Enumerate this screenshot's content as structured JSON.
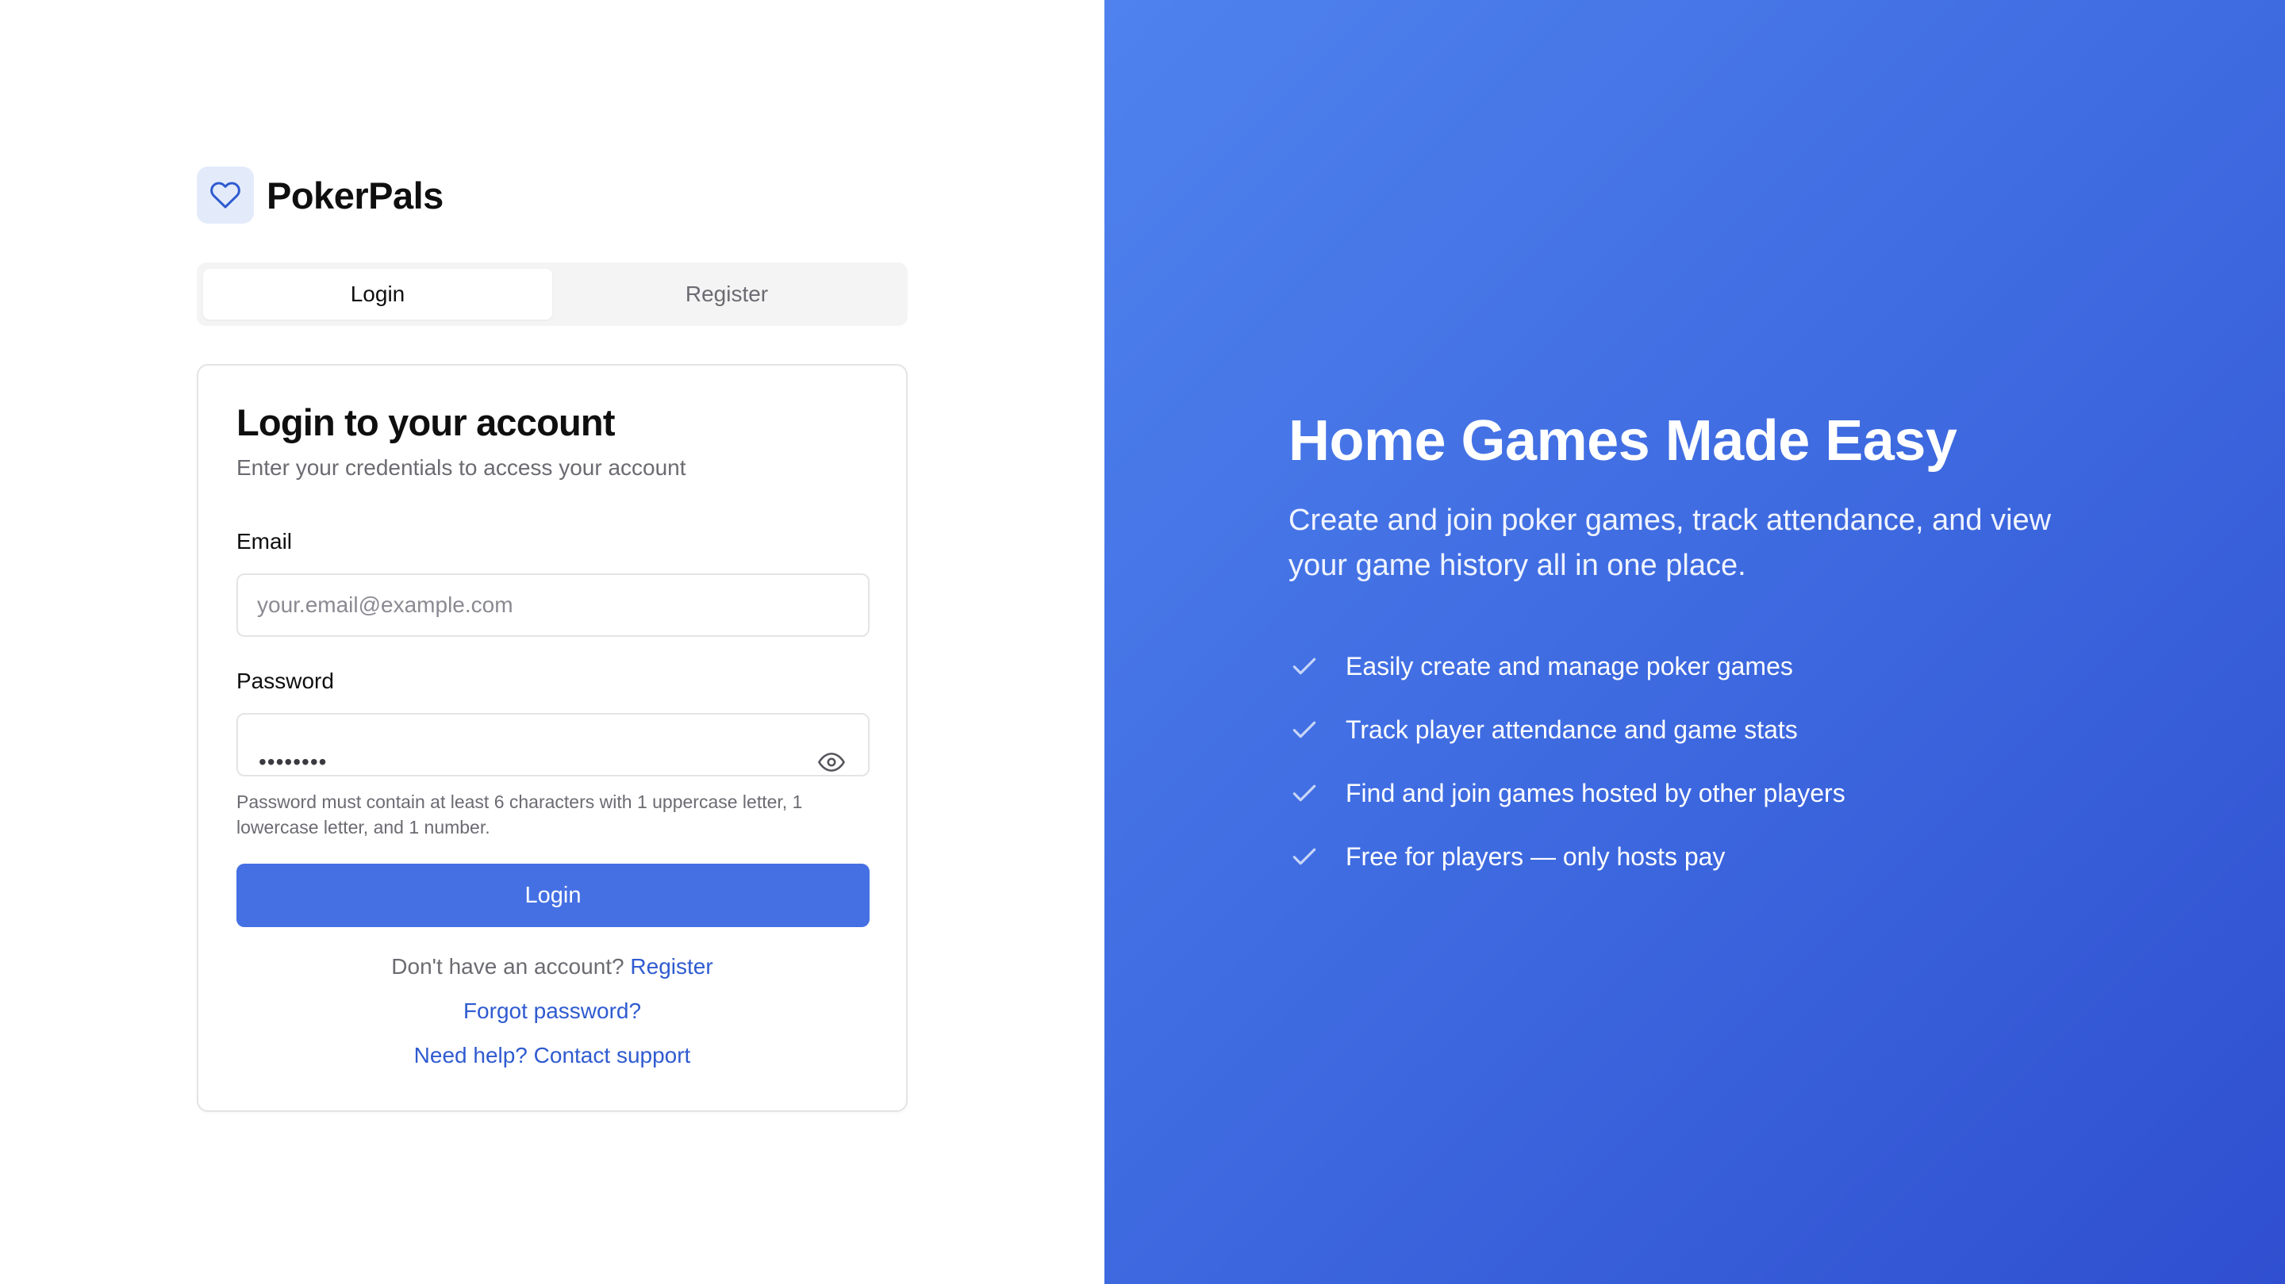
{
  "brand": {
    "name": "PokerPals",
    "logo_icon": "heart-icon",
    "logo_color": "#2f5bd0",
    "logo_bg": "#e3ebfb"
  },
  "tabs": [
    {
      "label": "Login",
      "active": true
    },
    {
      "label": "Register",
      "active": false
    }
  ],
  "card": {
    "title": "Login to your account",
    "subtitle": "Enter your credentials to access your account",
    "email": {
      "label": "Email",
      "placeholder": "your.email@example.com",
      "value": ""
    },
    "password": {
      "label": "Password",
      "masked_value": "••••••••",
      "toggle_icon": "eye-icon",
      "hint": "Password must contain at least 6 characters with 1 uppercase letter, 1 lowercase letter, and 1 number."
    },
    "submit_label": "Login",
    "no_account_text": "Don't have an account?",
    "register_link": "Register",
    "forgot_link": "Forgot password?",
    "support_link": "Need help? Contact support"
  },
  "hero": {
    "title": "Home Games Made Easy",
    "subtitle": "Create and join poker games, track attendance, and view your game history all in one place.",
    "features": [
      "Easily create and manage poker games",
      "Track player attendance and game stats",
      "Find and join games hosted by other players",
      "Free for players — only hosts pay"
    ],
    "feature_icon": "check-icon"
  },
  "colors": {
    "accent": "#4570e4",
    "link": "#2f5bd0",
    "hero_gradient_start": "#4f82ee",
    "hero_gradient_end": "#2f4fd0"
  }
}
